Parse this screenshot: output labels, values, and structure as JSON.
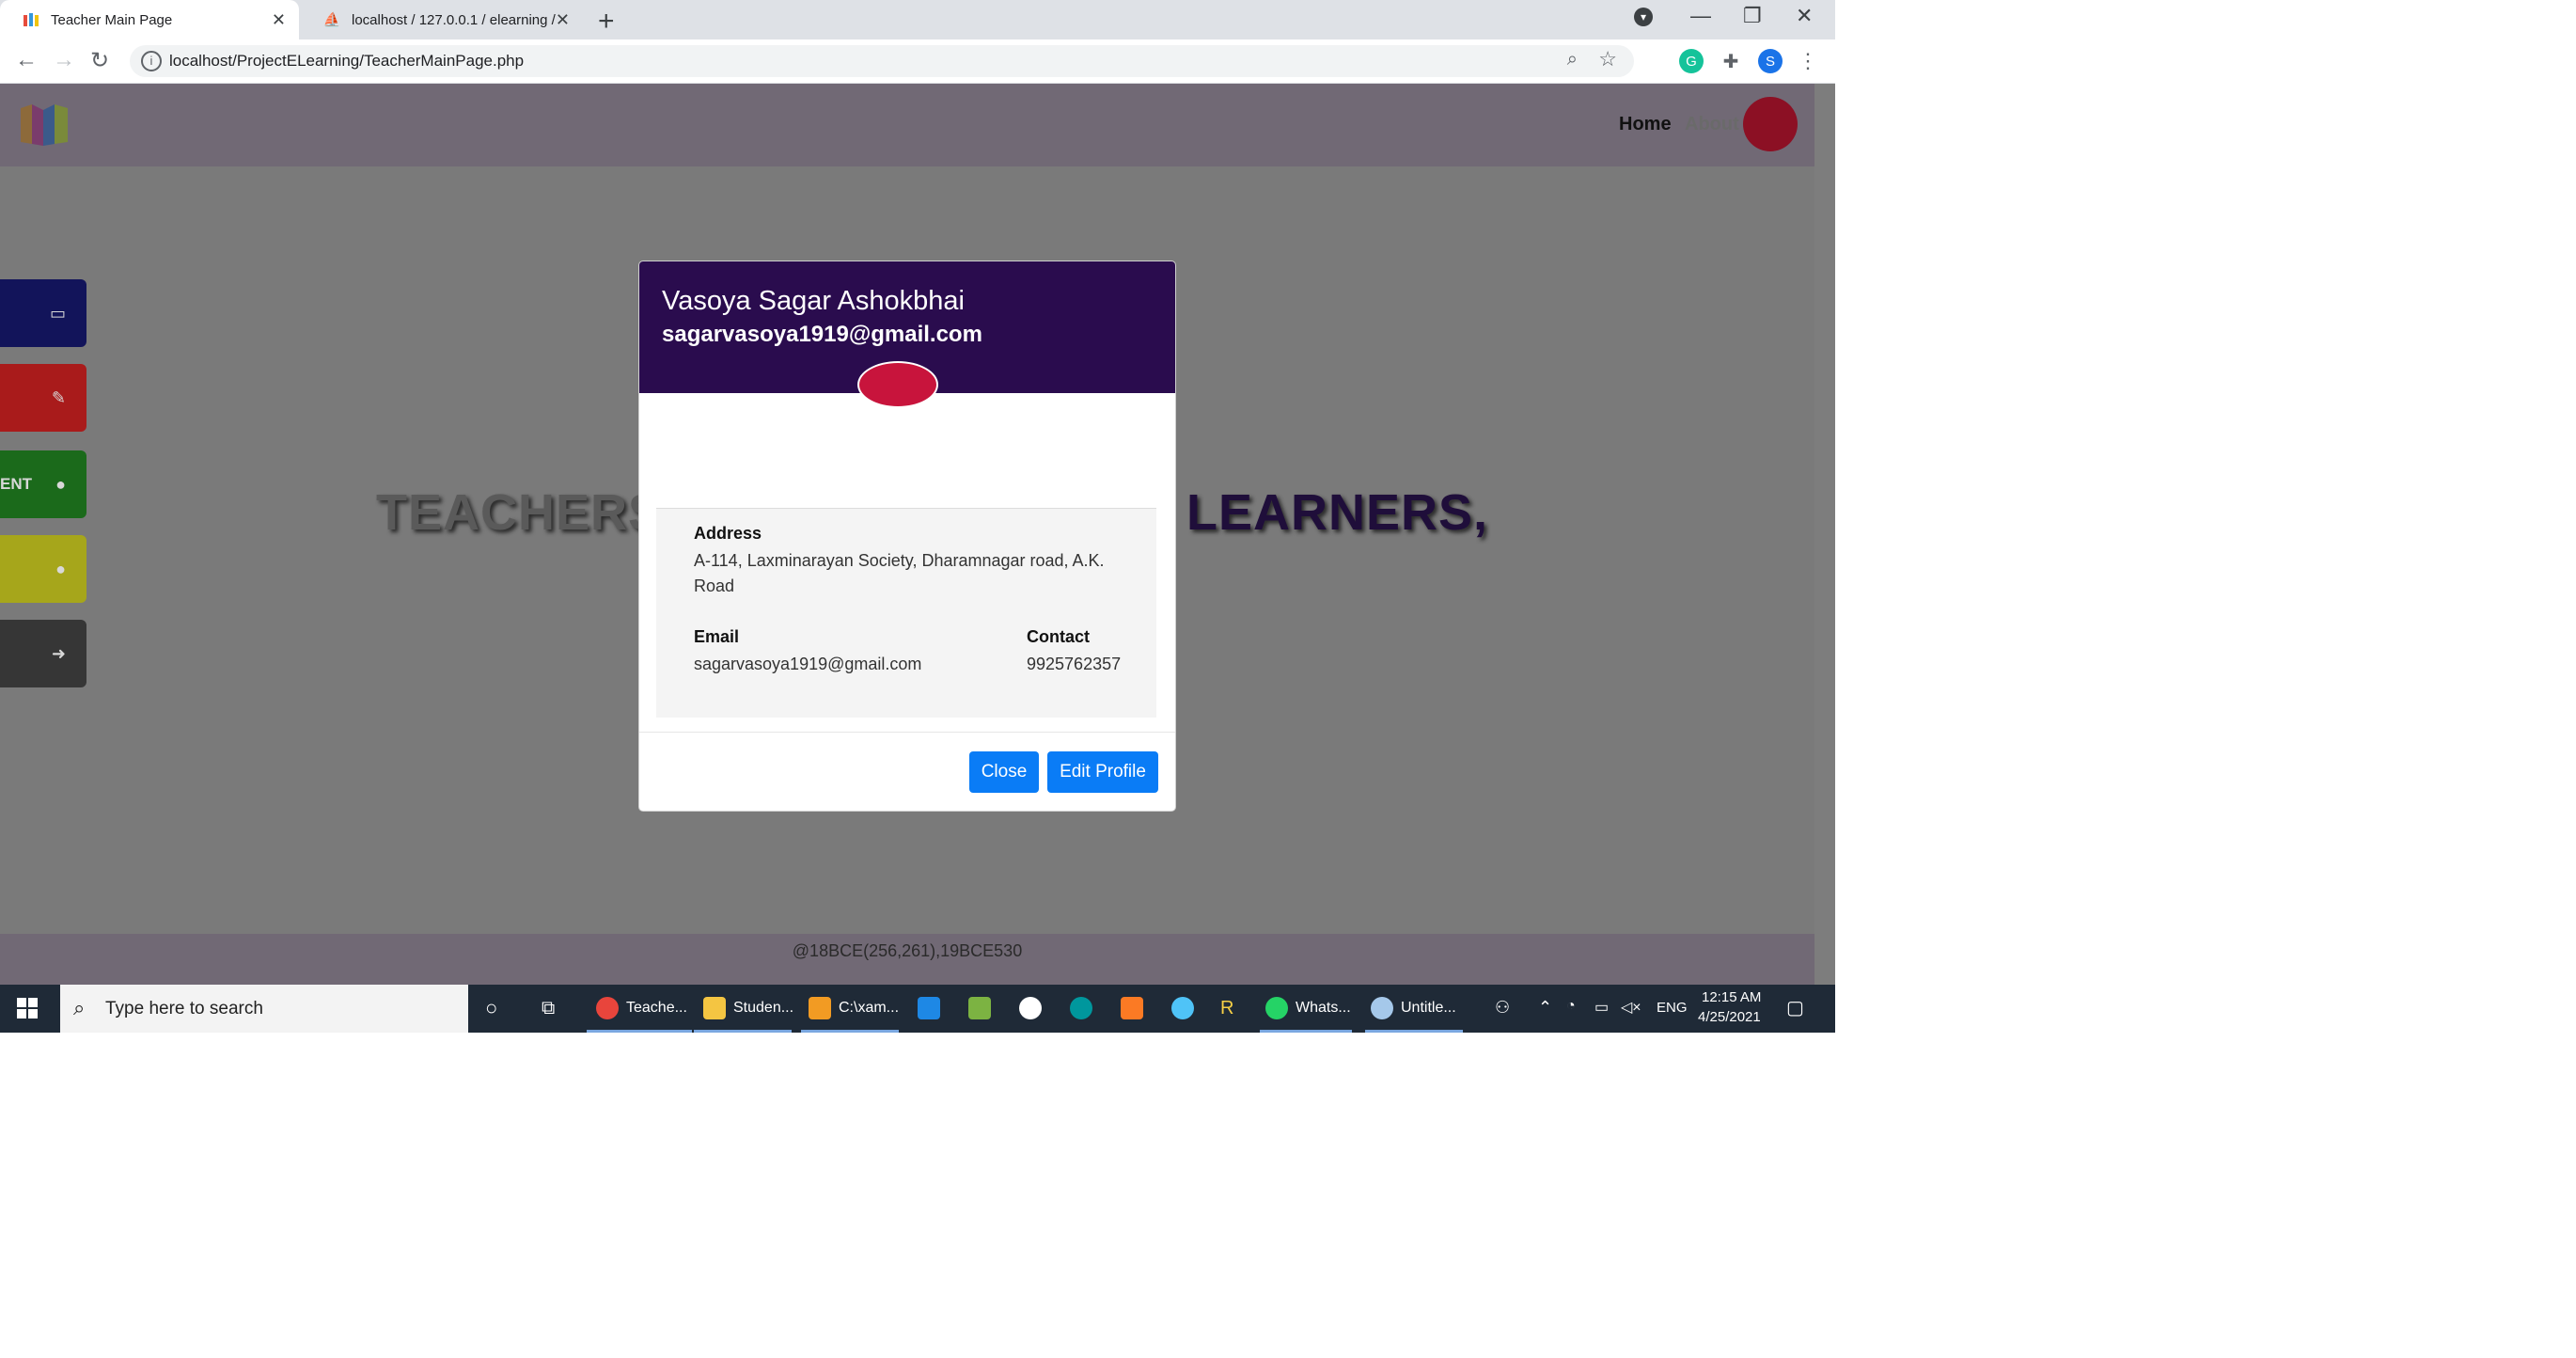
{
  "browser": {
    "tabs": [
      {
        "title": "Teacher Main Page",
        "active": true
      },
      {
        "title": "localhost / 127.0.0.1 / elearning /",
        "active": false
      }
    ],
    "new_tab": "+",
    "url": "localhost/ProjectELearning/TeacherMainPage.php",
    "profile_initial": "S"
  },
  "site": {
    "nav": {
      "home": "Home",
      "about": "About"
    },
    "sidebar": [
      {
        "color": "#12145a",
        "label": "",
        "icon": "book-icon",
        "glyph": "📖"
      },
      {
        "color": "#a91b1b",
        "label": "",
        "icon": "pencil-icon",
        "glyph": "✎"
      },
      {
        "color": "#1b6a1b",
        "label": "ENT",
        "icon": "user-icon",
        "glyph": "👤"
      },
      {
        "color": "#a6a61b",
        "label": "",
        "icon": "circle-icon",
        "glyph": "●"
      },
      {
        "color": "#363636",
        "label": "",
        "icon": "sign-out-icon",
        "glyph": "➜"
      }
    ],
    "hero_left": "TEACHERS I",
    "hero_right": "LEARNERS,",
    "footer": "@18BCE(256,261),19BCE530"
  },
  "modal": {
    "name": "Vasoya Sagar Ashokbhai",
    "email": "sagarvasoya1919@gmail.com",
    "address_label": "Address",
    "address_line1": "A-114, Laxminarayan Society, Dharamnagar road, A.K.",
    "address_line2": "Road",
    "email_label": "Email",
    "email_value": "sagarvasoya1919@gmail.com",
    "contact_label": "Contact",
    "contact_value": "9925762357",
    "close_label": "Close",
    "edit_label": "Edit Profile"
  },
  "taskbar": {
    "search_placeholder": "Type here to search",
    "apps": [
      {
        "label": "Teache...",
        "icon": "chrome-icon"
      },
      {
        "label": "Studen...",
        "icon": "folder-icon"
      },
      {
        "label": "C:\\xam...",
        "icon": "sublime-icon"
      },
      {
        "label": "Whats...",
        "icon": "whatsapp-icon"
      },
      {
        "label": "Untitle...",
        "icon": "paint-icon"
      }
    ],
    "lang": "ENG",
    "time": "12:15 AM",
    "date": "4/25/2021"
  }
}
